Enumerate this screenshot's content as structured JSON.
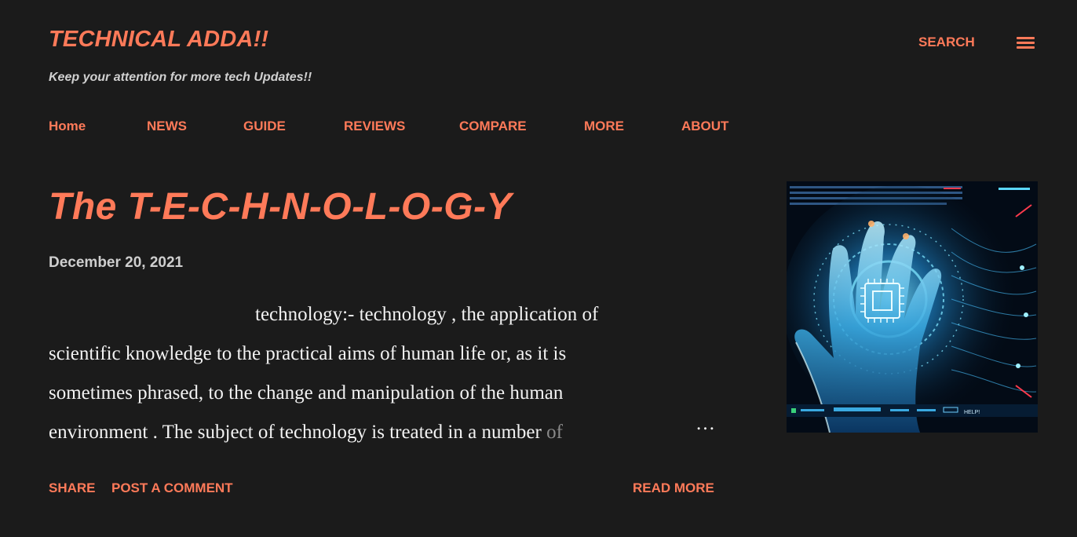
{
  "header": {
    "site_title": "TECHNICAL ADDA!!",
    "tagline": "Keep your attention for more tech Updates!!",
    "search_label": "SEARCH",
    "menu_icon": "hamburger-menu-icon"
  },
  "nav": {
    "items": [
      {
        "label": "Home"
      },
      {
        "label": "NEWS"
      },
      {
        "label": "GUIDE"
      },
      {
        "label": "REVIEWS"
      },
      {
        "label": "COMPARE"
      },
      {
        "label": "MORE"
      },
      {
        "label": "ABOUT"
      }
    ]
  },
  "post": {
    "title": "The T-E-C-H-N-O-L-O-G-Y",
    "date": "December 20, 2021",
    "snippet_lines": [
      "technology:- technology , the application of",
      "scientific knowledge to the practical aims of human life or, as it is",
      "sometimes phrased, to the change and manipulation of the human",
      "environment . The subject of technology is treated in a number"
    ],
    "snippet_fade": "of",
    "ellipsis": "…",
    "share_label": "SHARE",
    "comment_label": "POST A COMMENT",
    "read_more_label": "READ MORE",
    "thumbnail_caption": "HELP!"
  },
  "colors": {
    "background": "#1b1b1b",
    "accent": "#ff7a59",
    "text": "#f2f2f2",
    "muted": "#cfcfcf"
  }
}
